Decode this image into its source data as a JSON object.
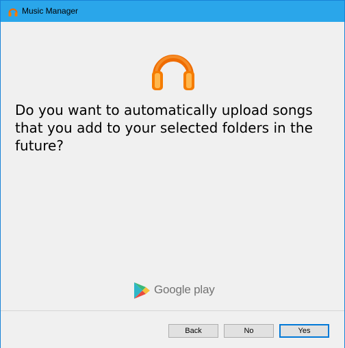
{
  "window": {
    "title": "Music Manager",
    "titlebar_color": "#2aa6ea",
    "icon": "headphones-icon"
  },
  "main": {
    "question": "Do you want to automatically upload songs that you add to your selected folders in the future?",
    "hero_icon": "orange-headphones-icon",
    "brand_text": "Google play",
    "brand_icon": "google-play-triangle-icon"
  },
  "buttons": {
    "back": "Back",
    "no": "No",
    "yes": "Yes"
  },
  "colors": {
    "accent": "#0078d7",
    "headphones_orange": "#f57c00"
  }
}
